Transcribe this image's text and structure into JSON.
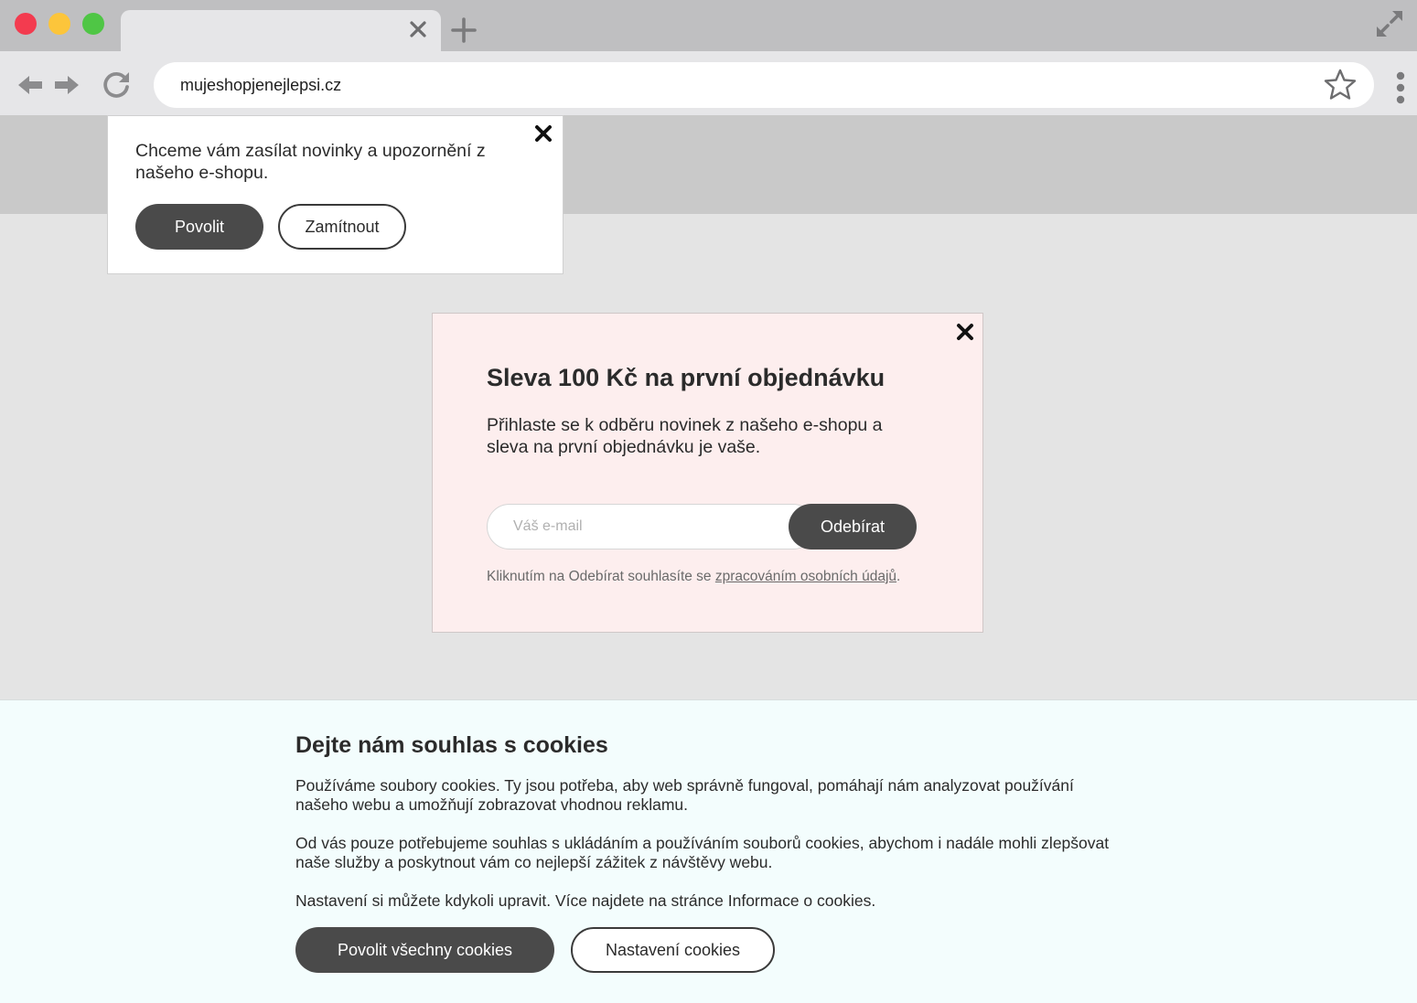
{
  "browser": {
    "url": "mujeshopjenejlepsi.cz"
  },
  "notification": {
    "text": "Chceme vám zasílat novinky a upozornění z našeho e-shopu.",
    "allow_label": "Povolit",
    "deny_label": "Zamítnout"
  },
  "discount_modal": {
    "title": "Sleva 100 Kč na první objednávku",
    "text": "Přihlaste se k odběru novinek z našeho e-shopu a sleva na první objednávku je vaše.",
    "email_placeholder": "Váš e-mail",
    "subscribe_label": "Odebírat",
    "consent_prefix": "Kliknutím na Odebírat souhlasíte se ",
    "consent_link": "zpracováním osobních údajů",
    "consent_suffix": "."
  },
  "cookie_banner": {
    "title": "Dejte nám souhlas s cookies",
    "paragraph1": "Používáme soubory cookies. Ty jsou potřeba, aby web správně fungoval, pomáhají nám analyzovat používání našeho webu a umožňují zobrazovat vhodnou reklamu.",
    "paragraph2": "Od vás pouze potřebujeme souhlas s ukládáním a používáním souborů cookies, abychom i nadále mohli zlepšovat naše služby a poskytnout vám co nejlepší zážitek z návštěvy webu.",
    "paragraph3": "Nastavení si můžete kdykoli upravit. Více najdete na stránce Informace o cookies.",
    "allow_all_label": "Povolit všechny cookies",
    "settings_label": "Nastavení cookies"
  },
  "colors": {
    "dark_button": "#4a4a4a",
    "modal_bg": "#fdeeee",
    "cookie_bg": "#f3fdfd",
    "page_bg": "#e4e4e4"
  },
  "icons": [
    "close-icon",
    "plus-icon",
    "fullscreen-icon",
    "back-arrow-icon",
    "forward-arrow-icon",
    "reload-icon",
    "star-icon",
    "kebab-menu-icon"
  ]
}
